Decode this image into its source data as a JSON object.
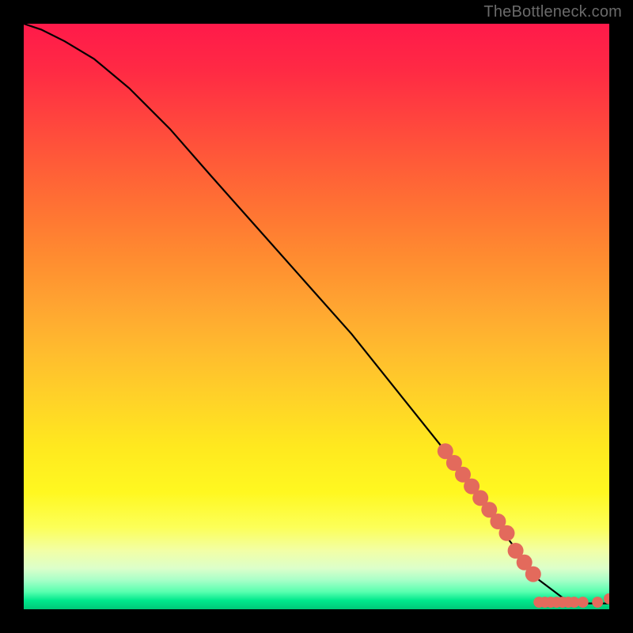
{
  "watermark": "TheBottleneck.com",
  "chart_data": {
    "type": "line",
    "title": "",
    "xlabel": "",
    "ylabel": "",
    "xlim": [
      0,
      100
    ],
    "ylim": [
      0,
      100
    ],
    "grid": false,
    "series": [
      {
        "name": "curve",
        "x": [
          0,
          3,
          7,
          12,
          18,
          25,
          32,
          40,
          48,
          56,
          64,
          72,
          78,
          82,
          85,
          88,
          92,
          96,
          100
        ],
        "values": [
          100,
          99,
          97,
          94,
          89,
          82,
          74,
          65,
          56,
          47,
          37,
          27,
          19,
          13,
          9,
          5,
          2,
          1,
          1
        ]
      }
    ],
    "markers": {
      "segment_dense": {
        "x": [
          72,
          73.5,
          75,
          76.5,
          78,
          79.5,
          81,
          82.5
        ],
        "values": [
          27,
          25,
          23,
          21,
          19,
          17,
          15,
          13
        ]
      },
      "segment_sparse": {
        "x": [
          84,
          85.5,
          87
        ],
        "values": [
          10,
          8,
          6
        ]
      },
      "bottom_cluster": {
        "x": [
          88,
          89,
          90,
          91,
          92,
          93,
          94
        ],
        "values": [
          1.2,
          1.2,
          1.2,
          1.2,
          1.2,
          1.2,
          1.2
        ]
      },
      "bottom_spaced": {
        "x": [
          95.5,
          98
        ],
        "values": [
          1.2,
          1.2
        ]
      },
      "end_dot": {
        "x": [
          100
        ],
        "values": [
          1.8
        ]
      }
    },
    "marker_color": "#e36a5c",
    "marker_radius_large": 10,
    "marker_radius_small": 7
  }
}
